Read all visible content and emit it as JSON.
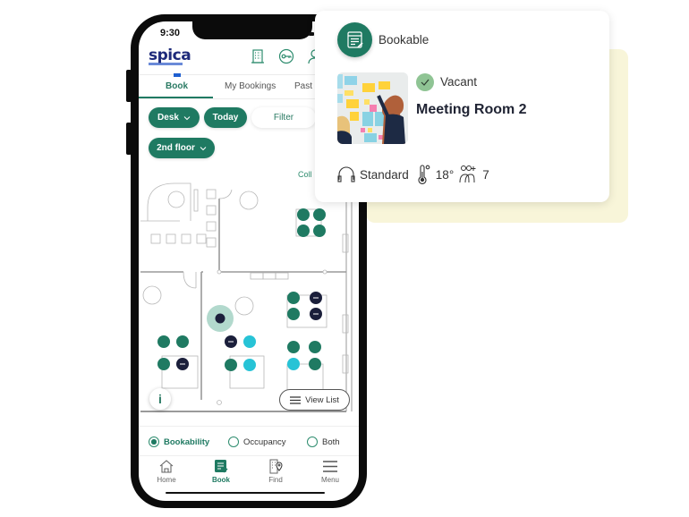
{
  "status_bar": {
    "time": "9:30"
  },
  "app": {
    "logo": "spica",
    "header_icons": [
      "building-icon",
      "key-icon",
      "user-icon"
    ]
  },
  "tabs": [
    {
      "label": "Book",
      "active": true
    },
    {
      "label": "My Bookings",
      "active": false
    },
    {
      "label": "Past I",
      "active": false
    }
  ],
  "filters": {
    "type_label": "Desk",
    "date_label": "Today",
    "filter_label": "Filter",
    "floor_label": "2nd floor"
  },
  "collapse_label": "Coll",
  "floorplan": {
    "desk_status_colors": {
      "bookable": "#1f7a62",
      "occupied": "#1b1f3b",
      "reserved": "#27c3d6"
    },
    "selected_marker_color": "#1b1f3b"
  },
  "view_list_label": "View List",
  "info_label": "i",
  "modes": [
    {
      "label": "Bookability",
      "selected": true
    },
    {
      "label": "Occupancy",
      "selected": false
    },
    {
      "label": "Both",
      "selected": false
    }
  ],
  "bottom_nav": [
    {
      "label": "Home",
      "icon": "home-icon",
      "active": false
    },
    {
      "label": "Book",
      "icon": "book-icon",
      "active": true
    },
    {
      "label": "Find",
      "icon": "find-icon",
      "active": false
    },
    {
      "label": "Menu",
      "icon": "menu-icon",
      "active": false
    }
  ],
  "card": {
    "type": "Bookable",
    "status": "Vacant",
    "room_name": "Meeting Room 2",
    "av_label": "Standard",
    "temperature": "18°",
    "capacity": "7"
  },
  "colors": {
    "brand": "#1f7a62",
    "backdrop": "#f8f5d9",
    "vacant": "#8fc494"
  }
}
